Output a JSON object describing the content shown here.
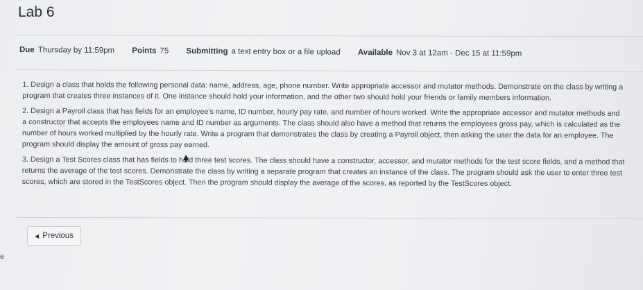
{
  "page": {
    "title": "Lab 6"
  },
  "meta": {
    "due_label": "Due",
    "due_value": "Thursday by 11:59pm",
    "points_label": "Points",
    "points_value": "75",
    "submitting_label": "Submitting",
    "submitting_value": "a text entry box or a file upload",
    "available_label": "Available",
    "available_value": "Nov 3 at 12am - Dec 15 at 11:59pm"
  },
  "description": {
    "paragraphs": [
      "1. Design a class that holds the following personal data: name, address, age, phone number. Write appropriate accessor and mutator methods. Demonstrate on the class by writing a program that creates three instances of it. One instance should hold your information, and the other two should hold your friends or family members information.",
      "2. Design a Payroll class that has fields for an employee's name, ID number, hourly pay rate, and number of hours worked. Write the appropriate accessor and mutator methods and a constructor that accepts the employees name and ID number as arguments. The class should also have a method that returns the employees gross pay, which is calculated as the number of hours worked multiplied by the hourly rate. Write a program that demonstrates the class by creating a Payroll object, then asking the user the data for an employee. The program should display the amount of gross pay earned.",
      "3. Design a Test Scores class that has fields to hold three test scores. The class should have a constructor, accessor, and mutator methods for the test score fields, and a method that returns the average of the test scores. Demonstrate the class by writing a separate program that creates an instance of the class. The program should ask the user to enter three test scores, which are stored in the TestScores object. Then the program should display the average of the scores, as reported by the TestScores object."
    ]
  },
  "navigation": {
    "previous_label": "Previous",
    "previous_icon": "chevron-left-icon"
  },
  "edge": {
    "glyph": "e"
  }
}
